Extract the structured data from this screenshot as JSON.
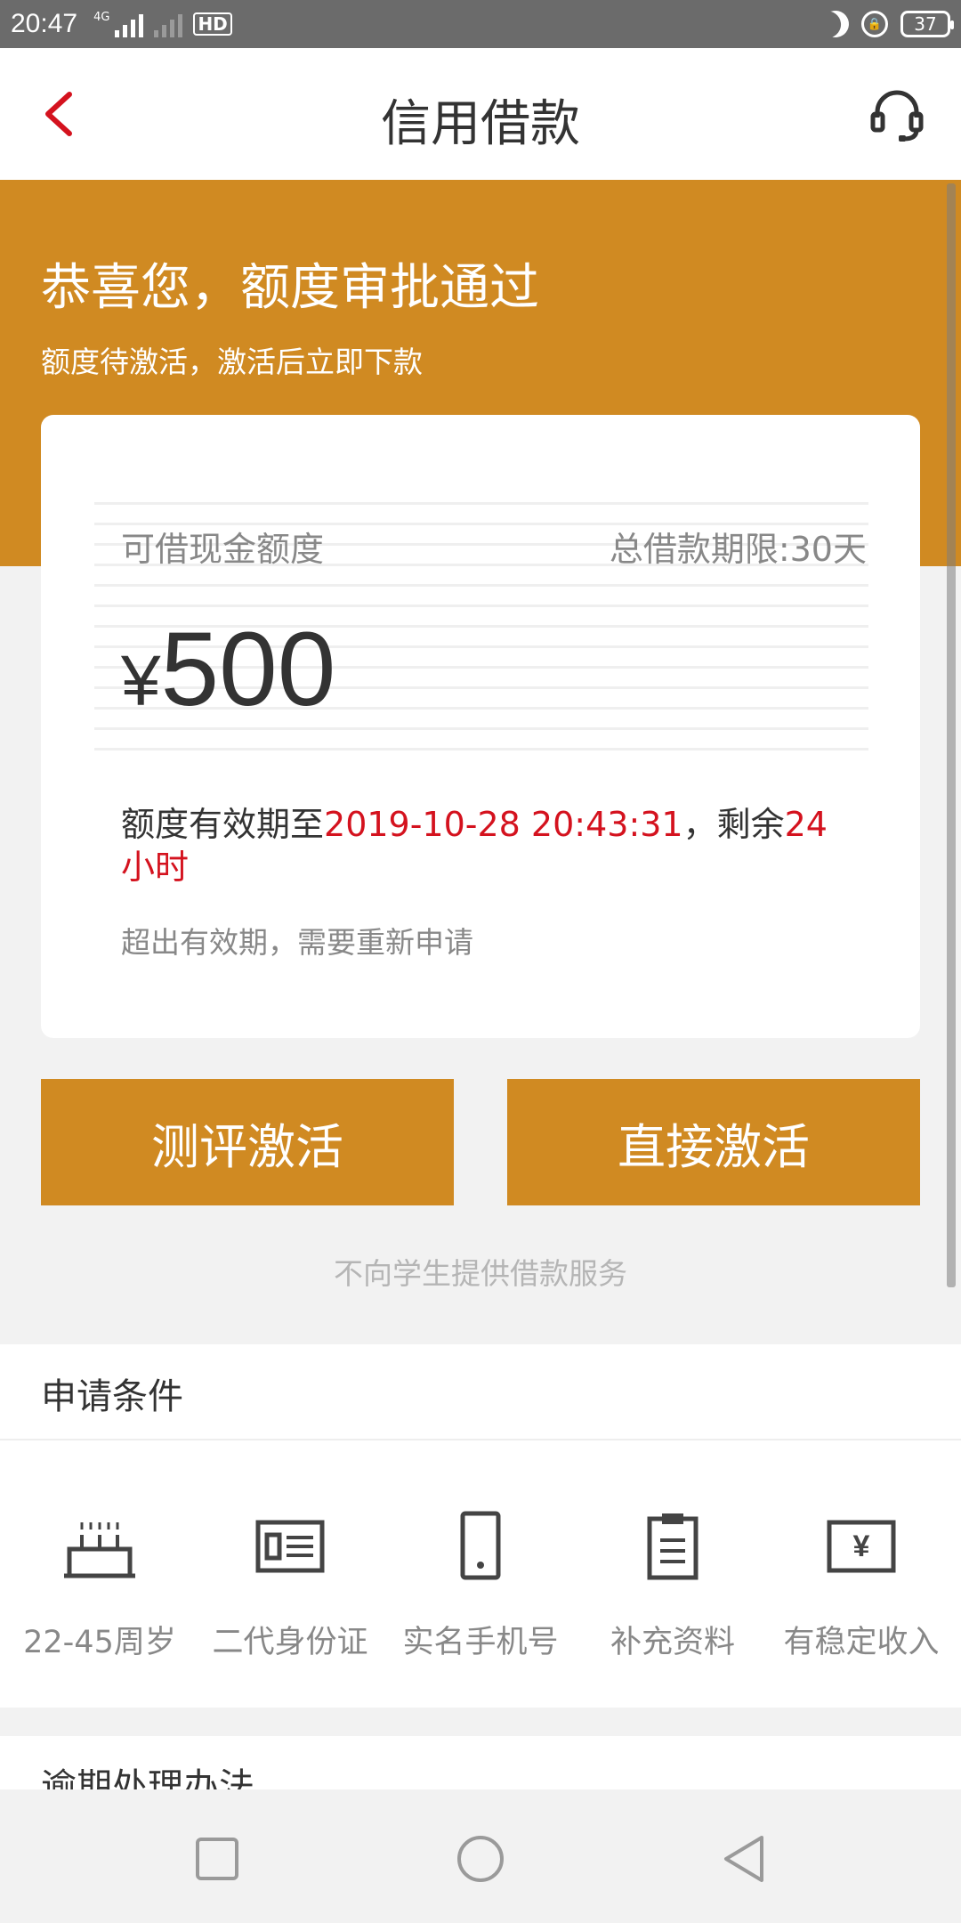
{
  "status_bar": {
    "time": "20:47",
    "network": "4G",
    "hd": "HD",
    "battery": "37"
  },
  "nav": {
    "title": "信用借款",
    "back_icon": "chevron-left-icon",
    "service_icon": "headset-icon"
  },
  "hero": {
    "title": "恭喜您，额度审批通过",
    "subtitle": "额度待激活，激活后立即下款"
  },
  "card": {
    "label": "可借现金额度",
    "term": "总借款期限:30天",
    "currency": "¥",
    "amount": "500",
    "valid_prefix": "额度有效期至",
    "valid_date": "2019-10-28 20:43:31",
    "valid_mid": "，剩余",
    "valid_remaining": "24小时",
    "note": "超出有效期，需要重新申请"
  },
  "buttons": {
    "evaluate": "测评激活",
    "direct": "直接激活"
  },
  "disclaimer": "不向学生提供借款服务",
  "conditions": {
    "title": "申请条件",
    "items": [
      {
        "label": "22-45周岁",
        "icon": "cake-icon"
      },
      {
        "label": "二代身份证",
        "icon": "id-card-icon"
      },
      {
        "label": "实名手机号",
        "icon": "phone-icon"
      },
      {
        "label": "补充资料",
        "icon": "clipboard-icon"
      },
      {
        "label": "有稳定收入",
        "icon": "income-icon"
      }
    ]
  },
  "overdue": {
    "title": "逾期处理办法"
  },
  "colors": {
    "accent": "#d08a22",
    "highlight": "#d4121e"
  }
}
